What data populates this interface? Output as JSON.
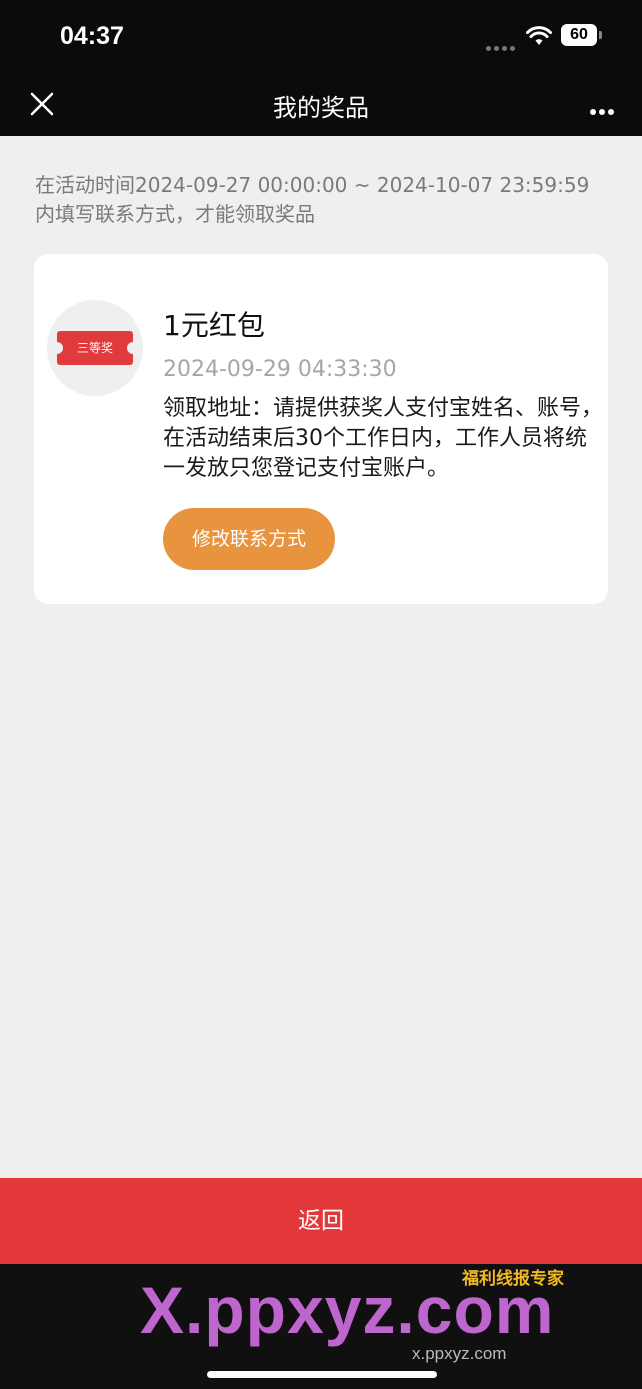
{
  "status_bar": {
    "time": "04:37",
    "battery": "60"
  },
  "nav": {
    "title": "我的奖品"
  },
  "notice": "在活动时间2024-09-27 00:00:00 ~ 2024-10-07 23:59:59内填写联系方式，才能领取奖品",
  "prize": {
    "badge": "三等奖",
    "name": "1元红包",
    "date": "2024-09-29 04:33:30",
    "description": "领取地址：请提供获奖人支付宝姓名、账号，在活动结束后30个工作日内，工作人员将统一发放只您登记支付宝账户。",
    "edit_button": "修改联系方式"
  },
  "footer": {
    "back_label": "返回"
  },
  "watermark": {
    "text": "X.ppxyz.com",
    "badge": "福利线报专家",
    "url": "x.ppxyz.com"
  },
  "colors": {
    "accent_red": "#e3383a",
    "button_orange": "#e8943f"
  }
}
